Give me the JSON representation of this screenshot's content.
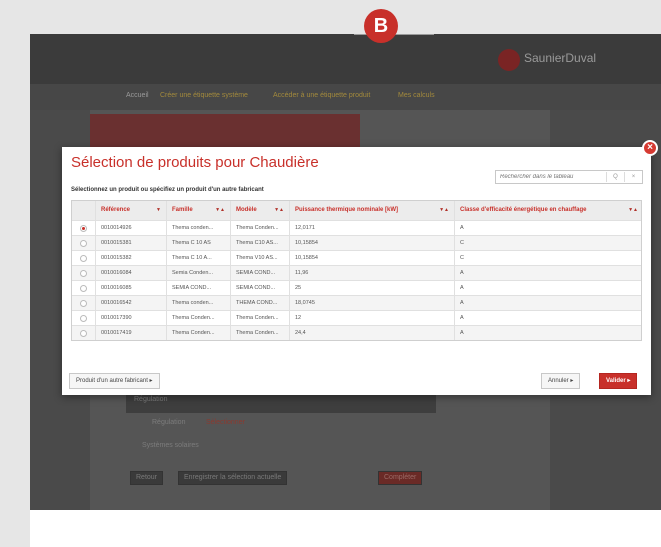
{
  "badge": {
    "letter": "B"
  },
  "brand": {
    "name": "SaunierDuval"
  },
  "nav": {
    "items": [
      "Accueil",
      "Créer une étiquette système",
      "Accéder à une étiquette produit",
      "Mes calculs"
    ]
  },
  "background": {
    "section_regulation": "Régulation",
    "regulation_label": "Régulation",
    "select_link": "Sélectionner",
    "section_solar": "Systèmes solaires",
    "back_button": "Retour",
    "save_button": "Enregistrer la sélection actuelle",
    "complete_button": "Compléter"
  },
  "modal": {
    "title": "Sélection de produits pour Chaudière",
    "subtitle": "Sélectionnez un produit ou spécifiez un produit d'un autre fabricant",
    "close_glyph": "×",
    "search": {
      "placeholder": "Rechercher dans le tableau",
      "search_glyph": "Q",
      "clear_glyph": "×"
    },
    "columns": [
      {
        "label": "Référence",
        "sort": "▼"
      },
      {
        "label": "Famille",
        "sort": "▼▲"
      },
      {
        "label": "Modèle",
        "sort": "▼▲"
      },
      {
        "label": "Puissance thermique nominale [kW]",
        "sort": "▼▲"
      },
      {
        "label": "Classe d'efficacité énergétique en chauffage",
        "sort": "▼▲"
      }
    ],
    "rows": [
      {
        "selected": true,
        "ref": "0010014926",
        "family": "Thema conden...",
        "model": "Thema Conden...",
        "power": "12,0171",
        "class": "A"
      },
      {
        "selected": false,
        "ref": "0010015381",
        "family": "Thema C 10 AS",
        "model": "Thema C10 AS...",
        "power": "10,15854",
        "class": "C"
      },
      {
        "selected": false,
        "ref": "0010015382",
        "family": "Thema C 10 A...",
        "model": "Thema V10 AS...",
        "power": "10,15854",
        "class": "C"
      },
      {
        "selected": false,
        "ref": "0010016084",
        "family": "Semia Conden...",
        "model": "SEMIA COND...",
        "power": "11,96",
        "class": "A"
      },
      {
        "selected": false,
        "ref": "0010016085",
        "family": "SEMIA COND...",
        "model": "SEMIA COND...",
        "power": "25",
        "class": "A"
      },
      {
        "selected": false,
        "ref": "0010016542",
        "family": "Thema conden...",
        "model": "THEMA COND...",
        "power": "18,0745",
        "class": "A"
      },
      {
        "selected": false,
        "ref": "0010017390",
        "family": "Thema Conden...",
        "model": "Thema Conden...",
        "power": "12",
        "class": "A"
      },
      {
        "selected": false,
        "ref": "0010017419",
        "family": "Thema Conden...",
        "model": "Thema Conden...",
        "power": "24,4",
        "class": "A"
      }
    ],
    "other_manufacturer_button": "Produit d'un autre fabricant ▸",
    "cancel_button": "Annuler ▸",
    "validate_button": "Valider ▸"
  }
}
